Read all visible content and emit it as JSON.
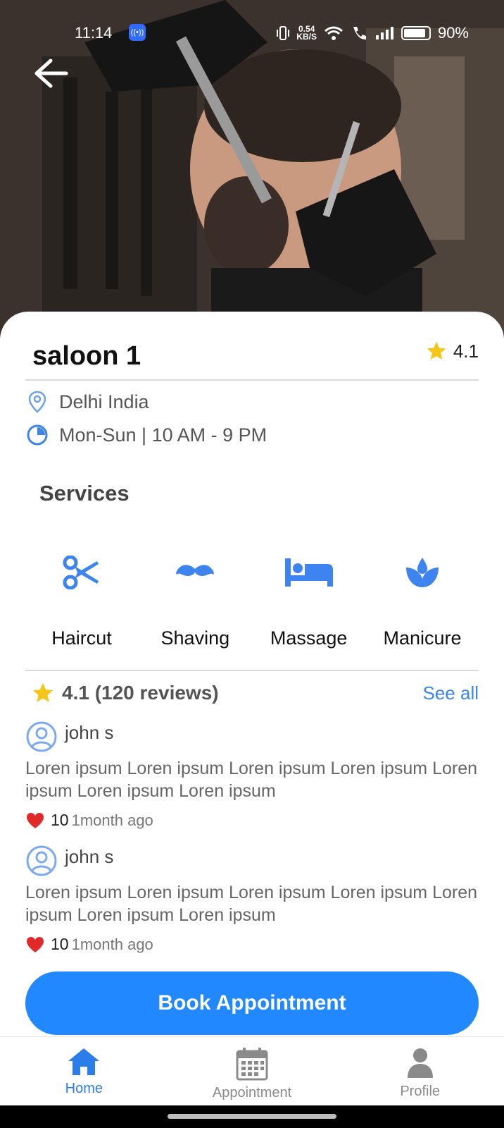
{
  "status_bar": {
    "time": "11:14",
    "net_speed": "0.54",
    "net_unit": "KB/S",
    "battery": "90%"
  },
  "salon": {
    "name": "saloon 1",
    "rating": "4.1",
    "location": "Delhi India",
    "hours": "Mon-Sun | 10 AM - 9 PM"
  },
  "services": {
    "title": "Services",
    "items": [
      {
        "label": "Haircut",
        "icon": "scissors-icon"
      },
      {
        "label": "Shaving",
        "icon": "mustache-icon"
      },
      {
        "label": "Massage",
        "icon": "bed-icon"
      },
      {
        "label": "Manicure",
        "icon": "spa-icon"
      }
    ]
  },
  "reviews": {
    "summary": "4.1 (120 reviews)",
    "see_all": "See all",
    "items": [
      {
        "name": "john s",
        "text": "Loren ipsum Loren ipsum Loren ipsum Loren ipsum Loren ipsum Loren ipsum Loren ipsum",
        "likes": "10",
        "ago": "1month ago"
      },
      {
        "name": "john s",
        "text": "Loren ipsum Loren ipsum Loren ipsum Loren ipsum Loren ipsum Loren ipsum Loren ipsum",
        "likes": "10",
        "ago": "1month ago"
      }
    ]
  },
  "cta": {
    "book": "Book Appointment"
  },
  "nav": {
    "items": [
      {
        "label": "Home",
        "icon": "home-icon",
        "active": true
      },
      {
        "label": "Appointment",
        "icon": "calendar-icon",
        "active": false
      },
      {
        "label": "Profile",
        "icon": "user-icon",
        "active": false
      }
    ]
  },
  "colors": {
    "accent": "#2288ff",
    "icon_blue": "#3d84f0",
    "link": "#3b86e8",
    "star": "#f5c518",
    "heart": "#e02a2a"
  }
}
